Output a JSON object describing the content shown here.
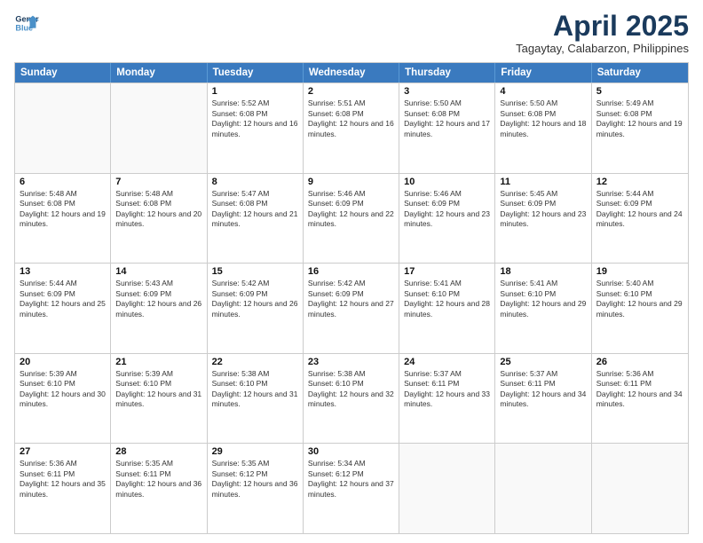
{
  "logo": {
    "line1": "General",
    "line2": "Blue"
  },
  "title": "April 2025",
  "subtitle": "Tagaytay, Calabarzon, Philippines",
  "days": [
    "Sunday",
    "Monday",
    "Tuesday",
    "Wednesday",
    "Thursday",
    "Friday",
    "Saturday"
  ],
  "weeks": [
    [
      {
        "day": "",
        "sunrise": "",
        "sunset": "",
        "daylight": ""
      },
      {
        "day": "",
        "sunrise": "",
        "sunset": "",
        "daylight": ""
      },
      {
        "day": "1",
        "sunrise": "Sunrise: 5:52 AM",
        "sunset": "Sunset: 6:08 PM",
        "daylight": "Daylight: 12 hours and 16 minutes."
      },
      {
        "day": "2",
        "sunrise": "Sunrise: 5:51 AM",
        "sunset": "Sunset: 6:08 PM",
        "daylight": "Daylight: 12 hours and 16 minutes."
      },
      {
        "day": "3",
        "sunrise": "Sunrise: 5:50 AM",
        "sunset": "Sunset: 6:08 PM",
        "daylight": "Daylight: 12 hours and 17 minutes."
      },
      {
        "day": "4",
        "sunrise": "Sunrise: 5:50 AM",
        "sunset": "Sunset: 6:08 PM",
        "daylight": "Daylight: 12 hours and 18 minutes."
      },
      {
        "day": "5",
        "sunrise": "Sunrise: 5:49 AM",
        "sunset": "Sunset: 6:08 PM",
        "daylight": "Daylight: 12 hours and 19 minutes."
      }
    ],
    [
      {
        "day": "6",
        "sunrise": "Sunrise: 5:48 AM",
        "sunset": "Sunset: 6:08 PM",
        "daylight": "Daylight: 12 hours and 19 minutes."
      },
      {
        "day": "7",
        "sunrise": "Sunrise: 5:48 AM",
        "sunset": "Sunset: 6:08 PM",
        "daylight": "Daylight: 12 hours and 20 minutes."
      },
      {
        "day": "8",
        "sunrise": "Sunrise: 5:47 AM",
        "sunset": "Sunset: 6:08 PM",
        "daylight": "Daylight: 12 hours and 21 minutes."
      },
      {
        "day": "9",
        "sunrise": "Sunrise: 5:46 AM",
        "sunset": "Sunset: 6:09 PM",
        "daylight": "Daylight: 12 hours and 22 minutes."
      },
      {
        "day": "10",
        "sunrise": "Sunrise: 5:46 AM",
        "sunset": "Sunset: 6:09 PM",
        "daylight": "Daylight: 12 hours and 23 minutes."
      },
      {
        "day": "11",
        "sunrise": "Sunrise: 5:45 AM",
        "sunset": "Sunset: 6:09 PM",
        "daylight": "Daylight: 12 hours and 23 minutes."
      },
      {
        "day": "12",
        "sunrise": "Sunrise: 5:44 AM",
        "sunset": "Sunset: 6:09 PM",
        "daylight": "Daylight: 12 hours and 24 minutes."
      }
    ],
    [
      {
        "day": "13",
        "sunrise": "Sunrise: 5:44 AM",
        "sunset": "Sunset: 6:09 PM",
        "daylight": "Daylight: 12 hours and 25 minutes."
      },
      {
        "day": "14",
        "sunrise": "Sunrise: 5:43 AM",
        "sunset": "Sunset: 6:09 PM",
        "daylight": "Daylight: 12 hours and 26 minutes."
      },
      {
        "day": "15",
        "sunrise": "Sunrise: 5:42 AM",
        "sunset": "Sunset: 6:09 PM",
        "daylight": "Daylight: 12 hours and 26 minutes."
      },
      {
        "day": "16",
        "sunrise": "Sunrise: 5:42 AM",
        "sunset": "Sunset: 6:09 PM",
        "daylight": "Daylight: 12 hours and 27 minutes."
      },
      {
        "day": "17",
        "sunrise": "Sunrise: 5:41 AM",
        "sunset": "Sunset: 6:10 PM",
        "daylight": "Daylight: 12 hours and 28 minutes."
      },
      {
        "day": "18",
        "sunrise": "Sunrise: 5:41 AM",
        "sunset": "Sunset: 6:10 PM",
        "daylight": "Daylight: 12 hours and 29 minutes."
      },
      {
        "day": "19",
        "sunrise": "Sunrise: 5:40 AM",
        "sunset": "Sunset: 6:10 PM",
        "daylight": "Daylight: 12 hours and 29 minutes."
      }
    ],
    [
      {
        "day": "20",
        "sunrise": "Sunrise: 5:39 AM",
        "sunset": "Sunset: 6:10 PM",
        "daylight": "Daylight: 12 hours and 30 minutes."
      },
      {
        "day": "21",
        "sunrise": "Sunrise: 5:39 AM",
        "sunset": "Sunset: 6:10 PM",
        "daylight": "Daylight: 12 hours and 31 minutes."
      },
      {
        "day": "22",
        "sunrise": "Sunrise: 5:38 AM",
        "sunset": "Sunset: 6:10 PM",
        "daylight": "Daylight: 12 hours and 31 minutes."
      },
      {
        "day": "23",
        "sunrise": "Sunrise: 5:38 AM",
        "sunset": "Sunset: 6:10 PM",
        "daylight": "Daylight: 12 hours and 32 minutes."
      },
      {
        "day": "24",
        "sunrise": "Sunrise: 5:37 AM",
        "sunset": "Sunset: 6:11 PM",
        "daylight": "Daylight: 12 hours and 33 minutes."
      },
      {
        "day": "25",
        "sunrise": "Sunrise: 5:37 AM",
        "sunset": "Sunset: 6:11 PM",
        "daylight": "Daylight: 12 hours and 34 minutes."
      },
      {
        "day": "26",
        "sunrise": "Sunrise: 5:36 AM",
        "sunset": "Sunset: 6:11 PM",
        "daylight": "Daylight: 12 hours and 34 minutes."
      }
    ],
    [
      {
        "day": "27",
        "sunrise": "Sunrise: 5:36 AM",
        "sunset": "Sunset: 6:11 PM",
        "daylight": "Daylight: 12 hours and 35 minutes."
      },
      {
        "day": "28",
        "sunrise": "Sunrise: 5:35 AM",
        "sunset": "Sunset: 6:11 PM",
        "daylight": "Daylight: 12 hours and 36 minutes."
      },
      {
        "day": "29",
        "sunrise": "Sunrise: 5:35 AM",
        "sunset": "Sunset: 6:12 PM",
        "daylight": "Daylight: 12 hours and 36 minutes."
      },
      {
        "day": "30",
        "sunrise": "Sunrise: 5:34 AM",
        "sunset": "Sunset: 6:12 PM",
        "daylight": "Daylight: 12 hours and 37 minutes."
      },
      {
        "day": "",
        "sunrise": "",
        "sunset": "",
        "daylight": ""
      },
      {
        "day": "",
        "sunrise": "",
        "sunset": "",
        "daylight": ""
      },
      {
        "day": "",
        "sunrise": "",
        "sunset": "",
        "daylight": ""
      }
    ]
  ]
}
